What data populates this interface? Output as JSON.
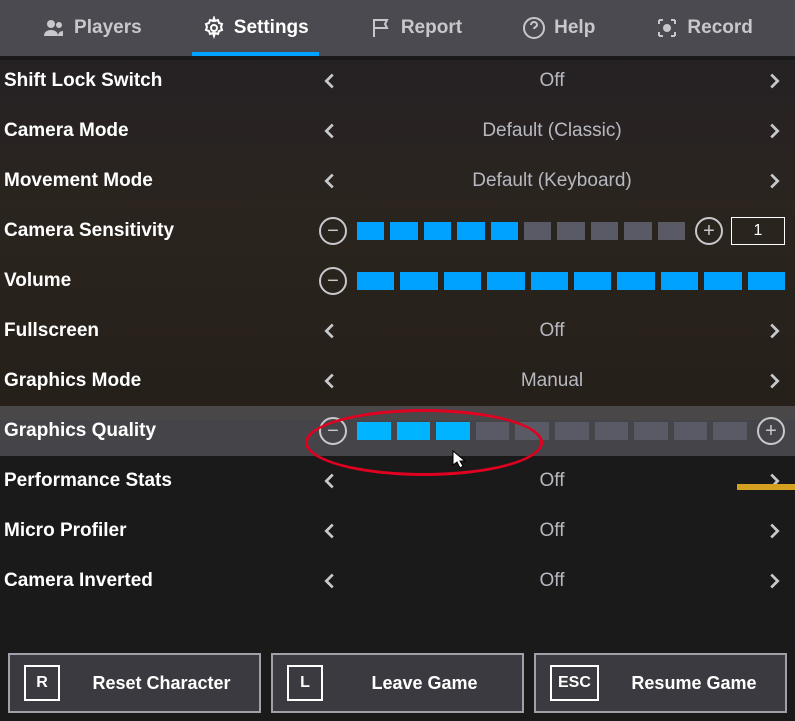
{
  "tabs": {
    "players": "Players",
    "settings": "Settings",
    "report": "Report",
    "help": "Help",
    "record": "Record"
  },
  "settings": {
    "shift_lock": {
      "label": "Shift Lock Switch",
      "value": "Off"
    },
    "camera_mode": {
      "label": "Camera Mode",
      "value": "Default (Classic)"
    },
    "movement_mode": {
      "label": "Movement Mode",
      "value": "Default (Keyboard)"
    },
    "camera_sensitivity": {
      "label": "Camera Sensitivity",
      "filled": 5,
      "total": 10,
      "numeric": "1"
    },
    "volume": {
      "label": "Volume",
      "filled": 10,
      "total": 10
    },
    "fullscreen": {
      "label": "Fullscreen",
      "value": "Off"
    },
    "graphics_mode": {
      "label": "Graphics Mode",
      "value": "Manual"
    },
    "graphics_quality": {
      "label": "Graphics Quality",
      "filled": 3,
      "total": 10
    },
    "performance_stats": {
      "label": "Performance Stats",
      "value": "Off"
    },
    "micro_profiler": {
      "label": "Micro Profiler",
      "value": "Off"
    },
    "camera_inverted": {
      "label": "Camera Inverted",
      "value": "Off"
    }
  },
  "bottom": {
    "reset": {
      "key": "R",
      "label": "Reset Character"
    },
    "leave": {
      "key": "L",
      "label": "Leave Game"
    },
    "resume": {
      "key": "ESC",
      "label": "Resume Game"
    }
  },
  "glyphs": {
    "minus": "−",
    "plus": "+"
  }
}
